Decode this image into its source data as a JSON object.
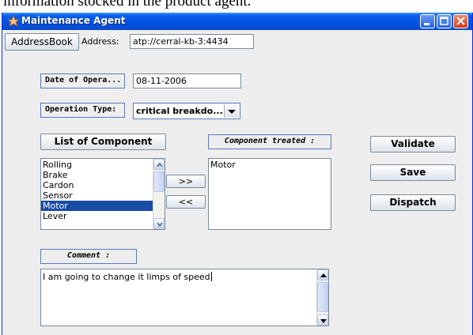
{
  "caption": "information stocked in the product agent.",
  "window": {
    "title": "Maintenance Agent",
    "controls": [
      "minimize-icon",
      "maximize-icon",
      "close-icon"
    ]
  },
  "toolbar": {
    "addressbook_label": "AddressBook",
    "address_label": "Address:",
    "address_value": "atp://cerral-kb-3:4434"
  },
  "form": {
    "date_label": "Date of Opera...",
    "date_value": "08-11-2006",
    "operation_type_label": "Operation Type:",
    "operation_type_value": "critical breakdo...",
    "list_of_component_label": "List of Component",
    "component_treated_label": "Component treated :",
    "components": [
      {
        "label": "Rolling",
        "selected": false
      },
      {
        "label": "Brake",
        "selected": false
      },
      {
        "label": "Cardon",
        "selected": false
      },
      {
        "label": "Sensor",
        "selected": false
      },
      {
        "label": "Motor",
        "selected": true
      },
      {
        "label": "Lever",
        "selected": false
      }
    ],
    "treated_components": [
      "Motor"
    ],
    "add_label": ">>",
    "remove_label": "<<",
    "comment_label": "Comment :",
    "comment_value": "I am going to change it limps of speed"
  },
  "actions": {
    "validate_label": "Validate",
    "save_label": "Save",
    "dispatch_label": "Dispatch"
  }
}
